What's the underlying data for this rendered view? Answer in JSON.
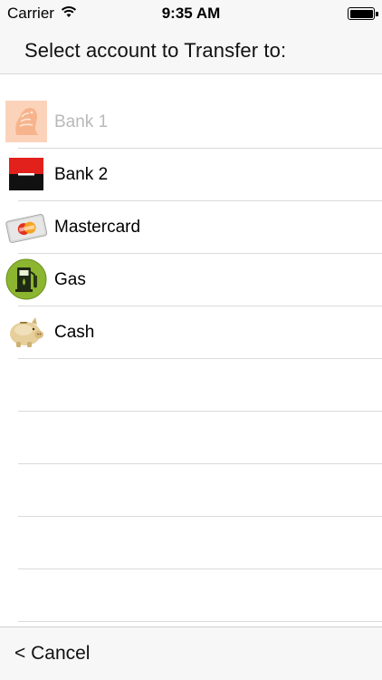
{
  "status_bar": {
    "carrier": "Carrier",
    "time": "9:35 AM"
  },
  "header": {
    "title": "Select account to Transfer to:"
  },
  "accounts": [
    {
      "label": "Bank 1",
      "icon": "lion-bank-icon",
      "disabled": true
    },
    {
      "label": "Bank 2",
      "icon": "red-black-bank-icon",
      "disabled": false
    },
    {
      "label": "Mastercard",
      "icon": "credit-card-icon",
      "disabled": false
    },
    {
      "label": "Gas",
      "icon": "gas-pump-icon",
      "disabled": false
    },
    {
      "label": "Cash",
      "icon": "piggy-bank-icon",
      "disabled": false
    }
  ],
  "toolbar": {
    "cancel_label": "< Cancel"
  },
  "colors": {
    "bar_background": "#f7f7f7",
    "separator": "#dadada",
    "disabled_text": "#b9b9b9",
    "gas_green": "#8cb530",
    "bank2_red": "#e2211c"
  }
}
